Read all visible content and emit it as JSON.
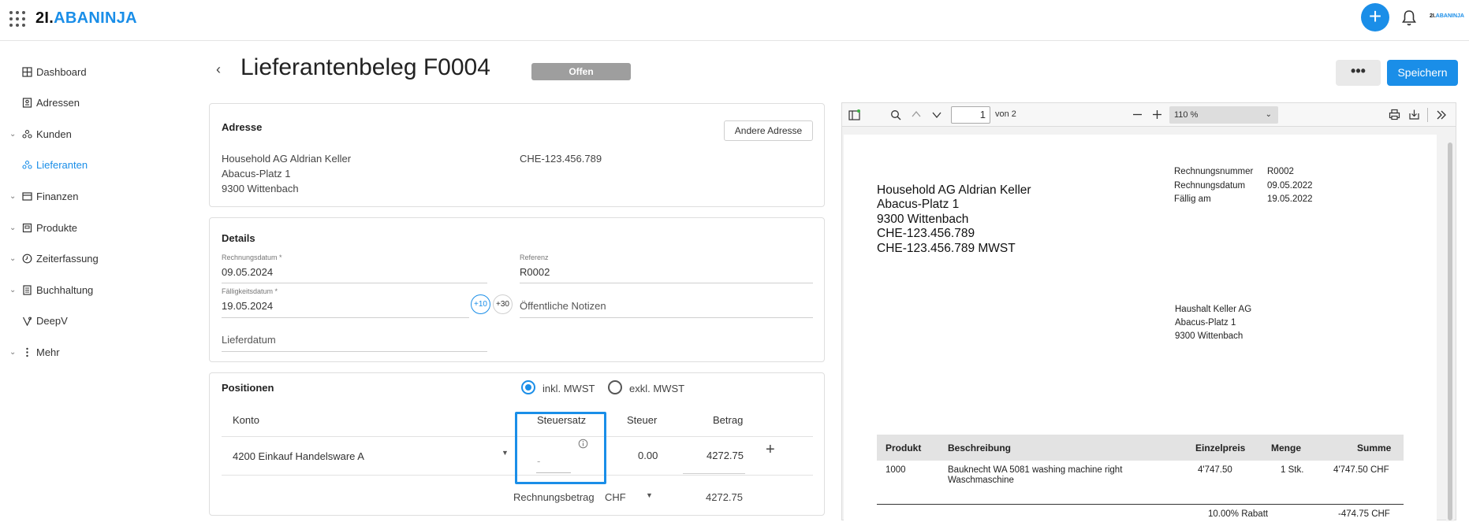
{
  "topbar": {
    "logo_part1": "2I.",
    "logo_part2": "ABANINJA",
    "mini_logo_part1": "2I.",
    "mini_logo_part2": "ABANINJA",
    "add_label": "+"
  },
  "sidebar": {
    "items": [
      {
        "label": "Dashboard"
      },
      {
        "label": "Adressen"
      },
      {
        "label": "Kunden"
      },
      {
        "label": "Lieferanten"
      },
      {
        "label": "Finanzen"
      },
      {
        "label": "Produkte"
      },
      {
        "label": "Zeiterfassung"
      },
      {
        "label": "Buchhaltung"
      },
      {
        "label": "DeepV"
      },
      {
        "label": "Mehr"
      }
    ]
  },
  "header": {
    "back": "‹",
    "title": "Lieferantenbeleg F0004",
    "status": "Offen",
    "more_label": "•••",
    "save_label": "Speichern"
  },
  "address": {
    "heading": "Adresse",
    "other_button": "Andere Adresse",
    "line1": "Household AG Aldrian Keller",
    "line2": "Abacus-Platz 1",
    "line3": "9300 Wittenbach",
    "vat": "CHE-123.456.789"
  },
  "details": {
    "heading": "Details",
    "invoice_date_label": "Rechnungsdatum *",
    "invoice_date": "09.05.2024",
    "reference_label": "Referenz",
    "reference": "R0002",
    "due_date_label": "Fälligkeitsdatum *",
    "due_date": "19.05.2024",
    "chip_10": "+10",
    "chip_30": "+30",
    "public_notes_placeholder": "Öffentliche Notizen",
    "delivery_date_placeholder": "Lieferdatum"
  },
  "positions": {
    "heading": "Positionen",
    "incl_vat": "inkl. MWST",
    "excl_vat": "exkl. MWST",
    "col_account": "Konto",
    "col_tax_rate": "Steuersatz",
    "col_tax": "Steuer",
    "col_amount": "Betrag",
    "row_account": "4200 Einkauf Handelsware A",
    "row_tax_rate": "-",
    "row_tax": "0.00",
    "row_amount": "4272.75",
    "add": "+",
    "total_label": "Rechnungsbetrag",
    "currency": "CHF",
    "total": "4272.75"
  },
  "viewer": {
    "page": "1",
    "page_of": "von 2",
    "zoom": "110 %",
    "sender_line1": "Household AG Aldrian Keller",
    "sender_line2": "Abacus-Platz 1",
    "sender_line3": "9300 Wittenbach",
    "sender_line4": "CHE-123.456.789",
    "sender_line5": "CHE-123.456.789 MWST",
    "meta_labels": [
      "Rechnungsnummer",
      "Rechnungsdatum",
      "Fällig am"
    ],
    "meta_values": [
      "R0002",
      "09.05.2022",
      "19.05.2022"
    ],
    "recipient_line1": "Haushalt Keller AG",
    "recipient_line2": "Abacus-Platz 1",
    "recipient_line3": "9300 Wittenbach",
    "table_headers": [
      "Produkt",
      "Beschreibung",
      "Einzelpreis",
      "Menge",
      "Summe"
    ],
    "row_product": "1000",
    "row_desc1": "Bauknecht WA 5081 washing machine right",
    "row_desc2": "Waschmaschine",
    "row_price": "4'747.50",
    "row_qty": "1 Stk.",
    "row_sum": "4'747.50 CHF",
    "discount_label": "10.00% Rabatt",
    "discount_value": "-474.75 CHF"
  },
  "colors": {
    "accent": "#1a8ee8",
    "status_badge": "#9e9e9e"
  }
}
